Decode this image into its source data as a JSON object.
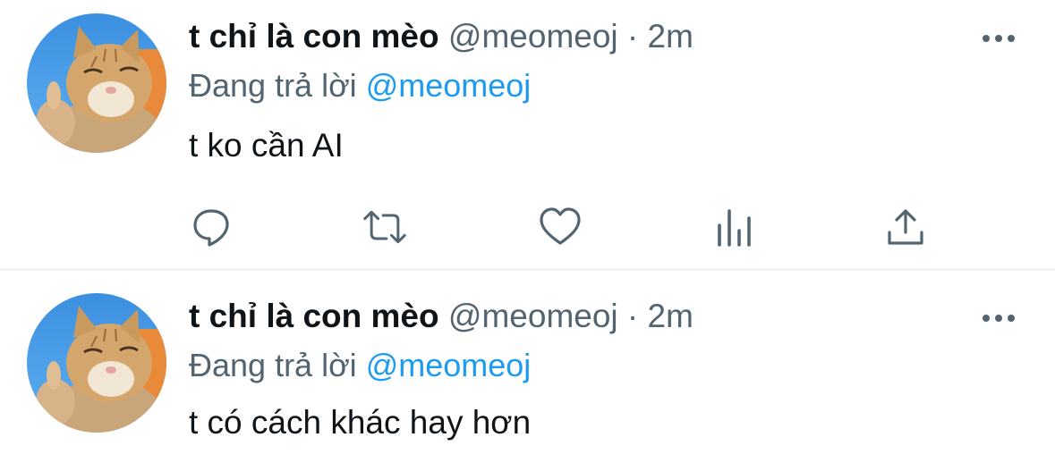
{
  "tweets": [
    {
      "display_name": "t chỉ là con mèo",
      "handle": "@meomeoj",
      "separator": "·",
      "time": "2m",
      "reply_prefix": "Đang trả lời",
      "reply_to": "@meomeoj",
      "text": "t ko cần AI",
      "avatar_icon": "cat-thumbs-up-avatar",
      "actions": [
        "reply-icon",
        "retweet-icon",
        "like-icon",
        "analytics-icon",
        "share-icon"
      ]
    },
    {
      "display_name": "t chỉ là con mèo",
      "handle": "@meomeoj",
      "separator": "·",
      "time": "2m",
      "reply_prefix": "Đang trả lời",
      "reply_to": "@meomeoj",
      "text": "t có cách khác hay hơn",
      "avatar_icon": "cat-thumbs-up-avatar"
    }
  ],
  "colors": {
    "text_primary": "#0f1419",
    "text_secondary": "#536471",
    "link": "#1d9bf0",
    "divider": "#eff3f4"
  }
}
